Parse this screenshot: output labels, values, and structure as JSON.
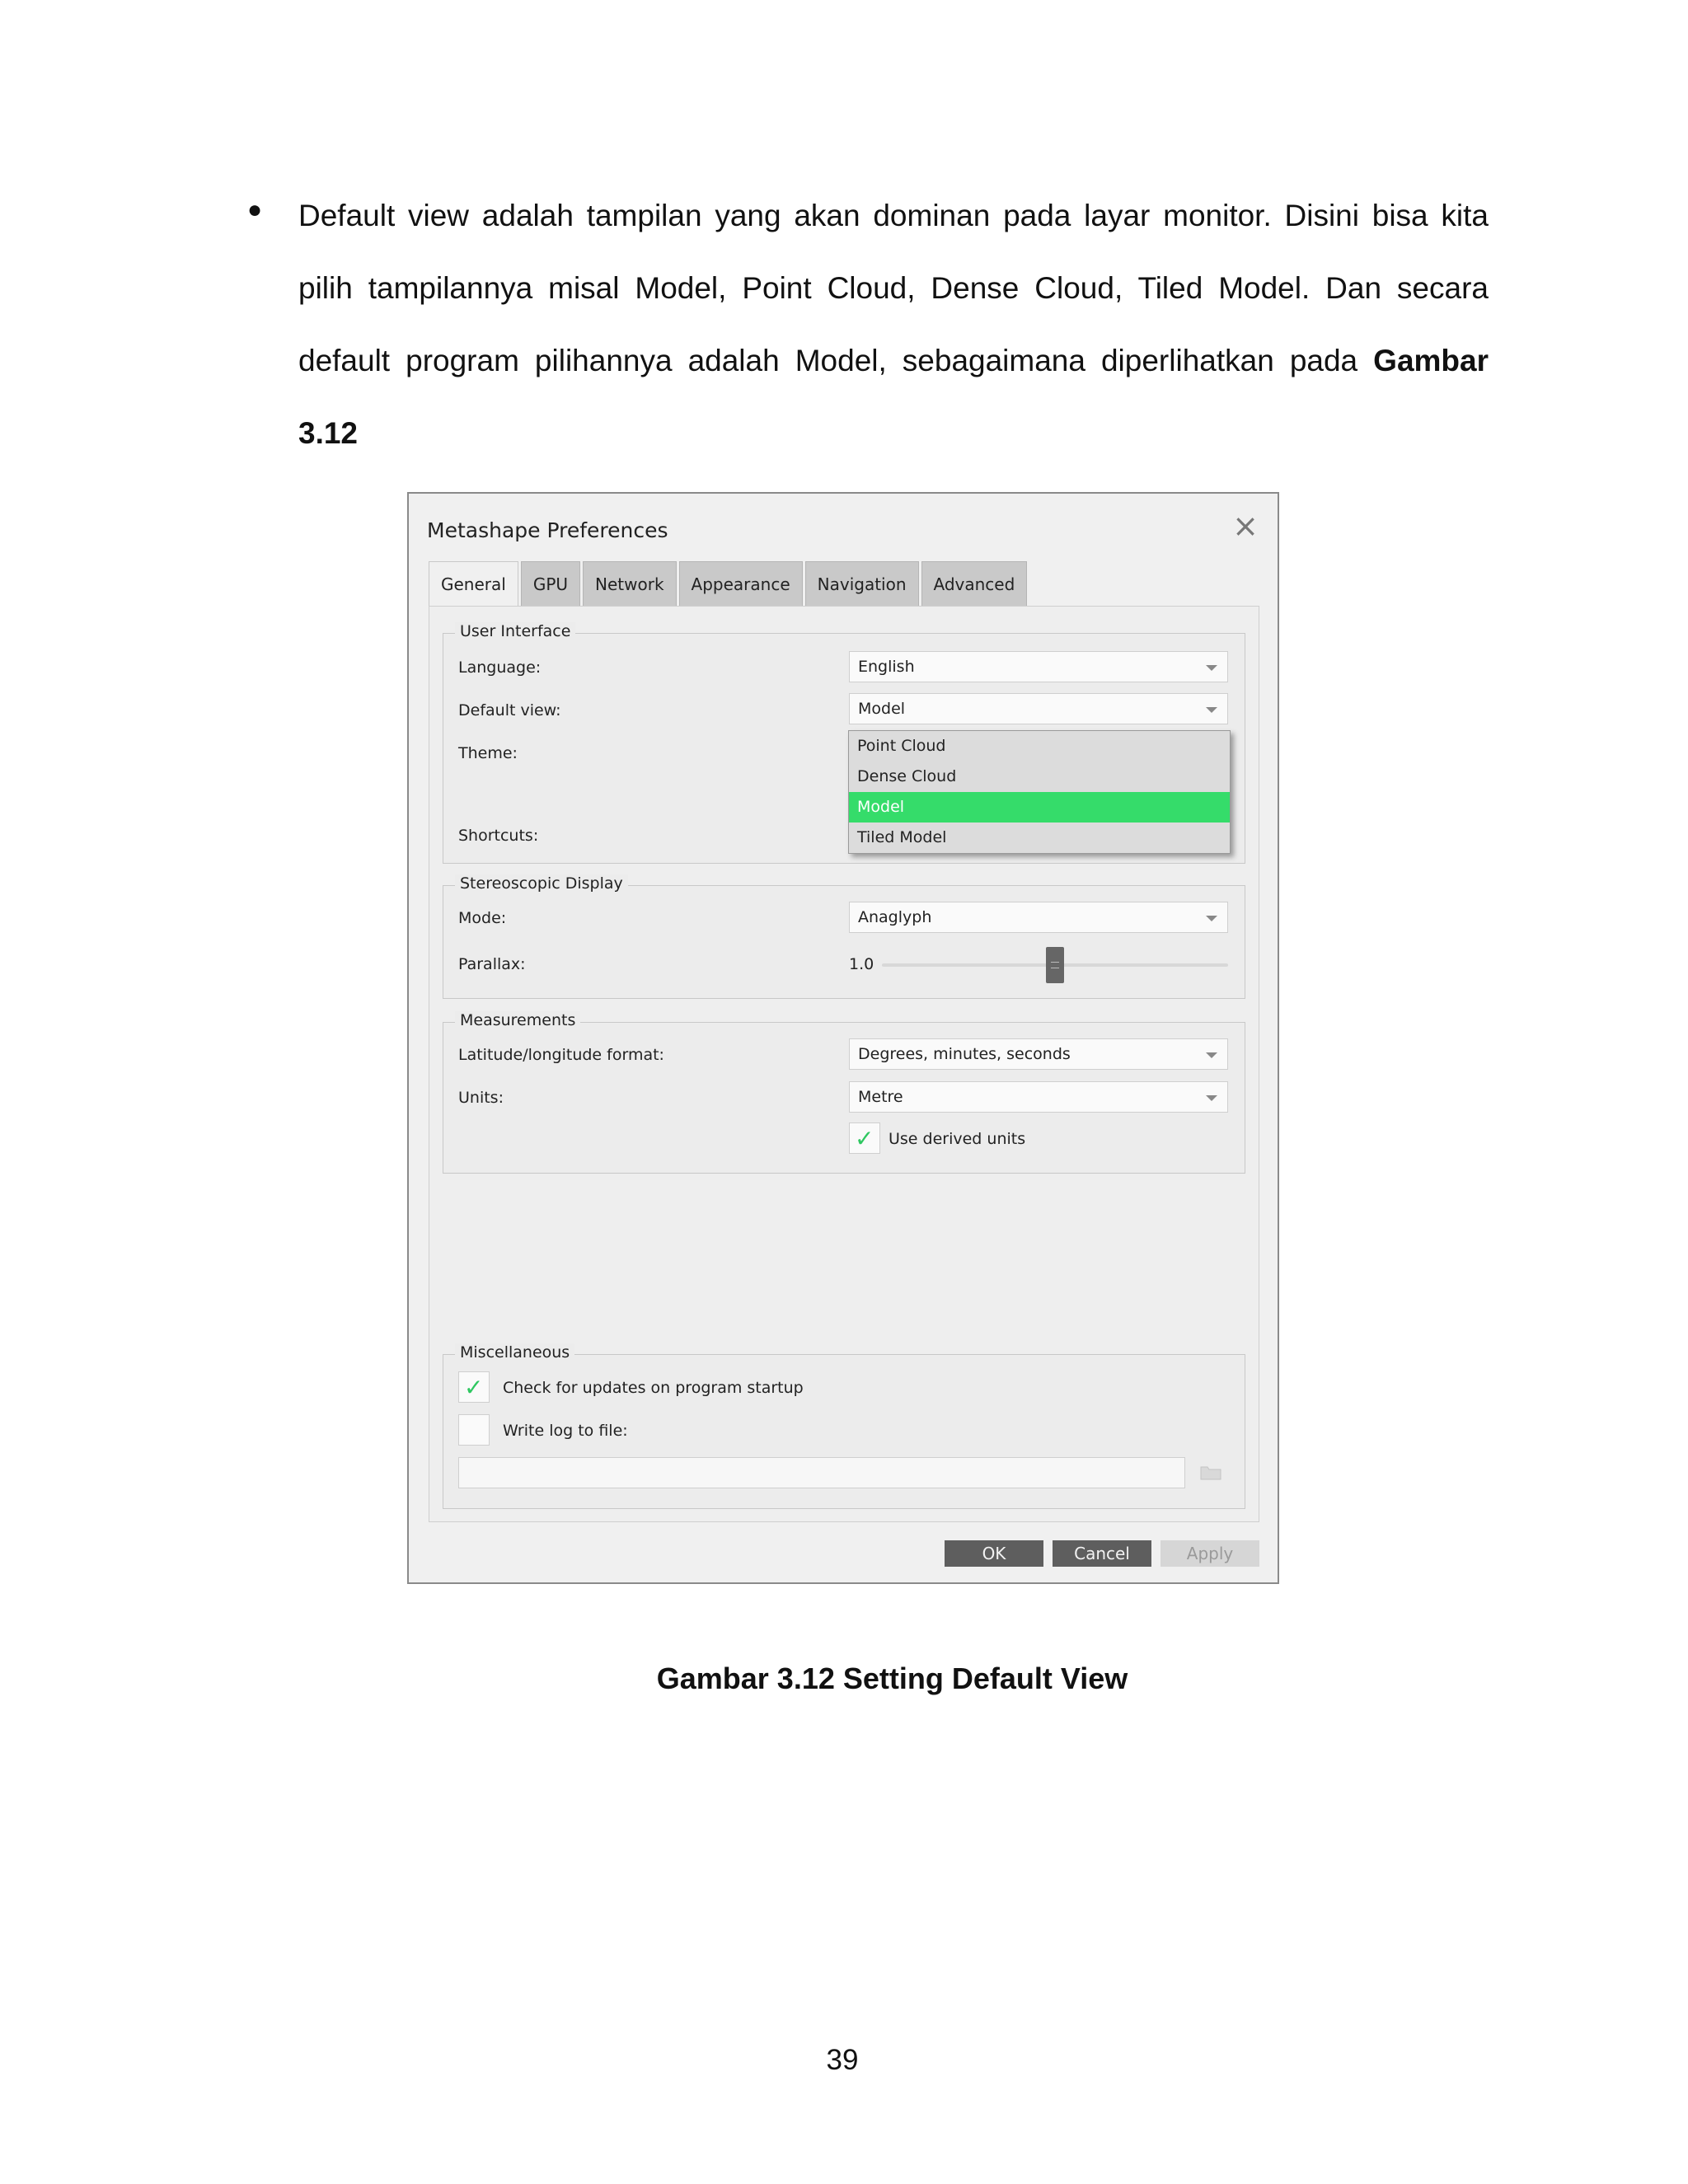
{
  "paragraph": {
    "bullet": "●",
    "lines": [
      "Default view adalah tampilan yang akan dominan pada layar monitor. Disini bisa kita",
      "pilih tampilannya misal Model, Point Cloud, Dense Cloud, Tiled Model. Dan secara",
      "default program pilihannya adalah Model, sebagaimana diperlihatkan pada",
      "3.12"
    ],
    "bold_end": "Gambar"
  },
  "dialog": {
    "title": "Metashape Preferences",
    "close_icon": "close-icon",
    "tabs": [
      "General",
      "GPU",
      "Network",
      "Appearance",
      "Navigation",
      "Advanced"
    ],
    "active_tab": "General",
    "user_interface": {
      "legend": "User Interface",
      "language_label": "Language:",
      "language_value": "English",
      "default_view_label": "Default view:",
      "default_view_value": "Model",
      "theme_label": "Theme:",
      "shortcuts_label": "Shortcuts:",
      "dropdown_options": [
        "Point Cloud",
        "Dense Cloud",
        "Model",
        "Tiled Model"
      ],
      "dropdown_selected": "Model"
    },
    "stereo": {
      "legend": "Stereoscopic Display",
      "mode_label": "Mode:",
      "mode_value": "Anaglyph",
      "parallax_label": "Parallax:",
      "parallax_value": "1.0",
      "parallax_slider_fraction": 0.5
    },
    "measurements": {
      "legend": "Measurements",
      "latlon_label": "Latitude/longitude format:",
      "latlon_value": "Degrees, minutes, seconds",
      "units_label": "Units:",
      "units_value": "Metre",
      "derived_units_label": "Use derived units",
      "derived_units_checked": true
    },
    "misc": {
      "legend": "Miscellaneous",
      "check_updates_label": "Check for updates on program startup",
      "check_updates_checked": true,
      "write_log_label": "Write log to file:",
      "write_log_checked": false,
      "log_path_value": ""
    },
    "buttons": {
      "ok": "OK",
      "cancel": "Cancel",
      "apply": "Apply"
    }
  },
  "caption": "Gambar 3.12 Setting Default View",
  "page_number": "39",
  "colors": {
    "selection": "#35dc6a",
    "checkmark": "#2ec760",
    "button": "#5e5e5e"
  }
}
